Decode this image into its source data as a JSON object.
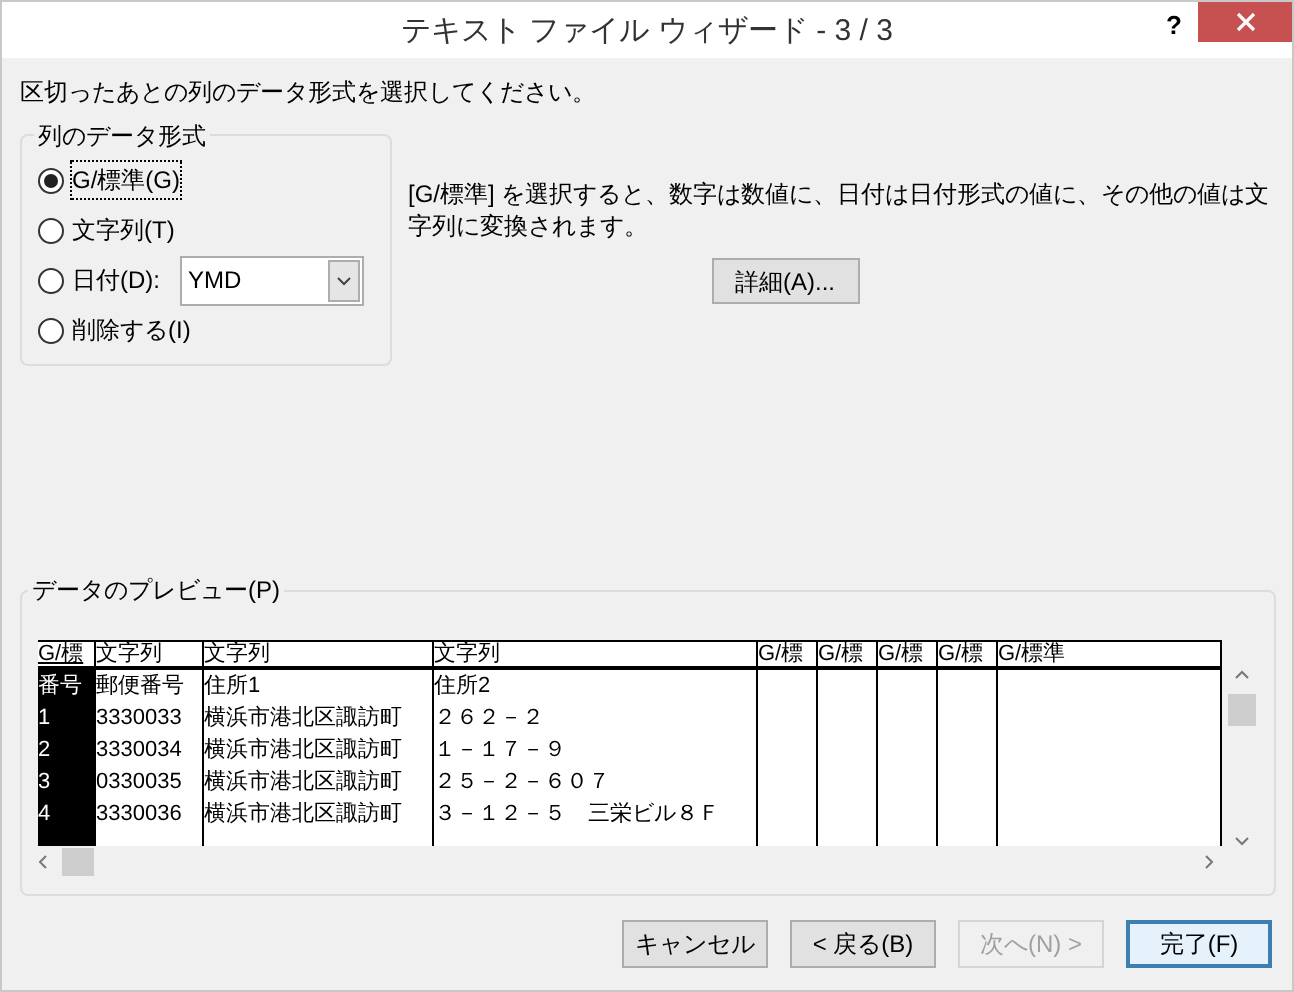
{
  "window": {
    "title": "テキスト ファイル ウィザード - 3 / 3",
    "help": "?"
  },
  "instruction": "区切ったあとの列のデータ形式を選択してください。",
  "format_group": {
    "label": "列のデータ形式",
    "options": [
      {
        "kind": "plain",
        "label": "G/標準(G)",
        "selected": true
      },
      {
        "kind": "plain",
        "label": "文字列(T)",
        "selected": false
      },
      {
        "kind": "date",
        "label": "日付(D):",
        "selected": false,
        "dropdown": "YMD"
      },
      {
        "kind": "plain",
        "label": "削除する(I)",
        "selected": false
      }
    ]
  },
  "description": "[G/標準] を選択すると、数字は数値に、日付は日付形式の値に、その他の値は文字列に変換されます。",
  "advanced_button": "詳細(A)...",
  "preview": {
    "label": "データのプレビュー(P)",
    "columns": [
      {
        "format": "G/標",
        "selected": true
      },
      {
        "format": "文字列",
        "selected": false
      },
      {
        "format": "文字列",
        "selected": false
      },
      {
        "format": "文字列",
        "selected": false
      },
      {
        "format": "G/標",
        "selected": false
      },
      {
        "format": "G/標",
        "selected": false
      },
      {
        "format": "G/標",
        "selected": false
      },
      {
        "format": "G/標",
        "selected": false
      },
      {
        "format": "G/標準",
        "selected": false
      }
    ],
    "rows": [
      [
        "番号",
        "郵便番号",
        "住所1",
        "住所2"
      ],
      [
        "1",
        "3330033",
        "横浜市港北区諏訪町",
        "２６２－２"
      ],
      [
        "2",
        "3330034",
        "横浜市港北区諏訪町",
        "１－１７－９"
      ],
      [
        "3",
        "0330035",
        "横浜市港北区諏訪町",
        "２５－２－６０７"
      ],
      [
        "4",
        "3330036",
        "横浜市港北区諏訪町",
        "３－１２－５　三栄ビル８Ｆ"
      ]
    ]
  },
  "buttons": [
    {
      "label": "キャンセル",
      "disabled": false,
      "default": false
    },
    {
      "label": "< 戻る(B)",
      "disabled": false,
      "default": false
    },
    {
      "label": "次へ(N) >",
      "disabled": true,
      "default": false
    },
    {
      "label": "完了(F)",
      "disabled": false,
      "default": true
    }
  ]
}
